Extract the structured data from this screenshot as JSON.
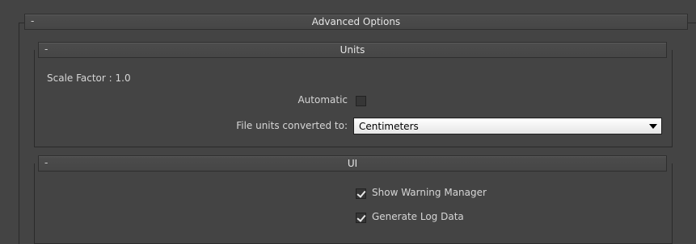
{
  "advanced_options": {
    "collapse": "-",
    "title": "Advanced Options"
  },
  "units": {
    "collapse": "-",
    "title": "Units",
    "scale_factor": "Scale Factor : 1.0",
    "automatic_label": "Automatic",
    "automatic_checked": false,
    "file_units_label": "File units converted to:",
    "file_units_value": "Centimeters"
  },
  "ui": {
    "collapse": "-",
    "title": "UI",
    "show_warning_manager_label": "Show Warning Manager",
    "show_warning_manager_checked": true,
    "generate_log_data_label": "Generate Log Data",
    "generate_log_data_checked": true
  }
}
